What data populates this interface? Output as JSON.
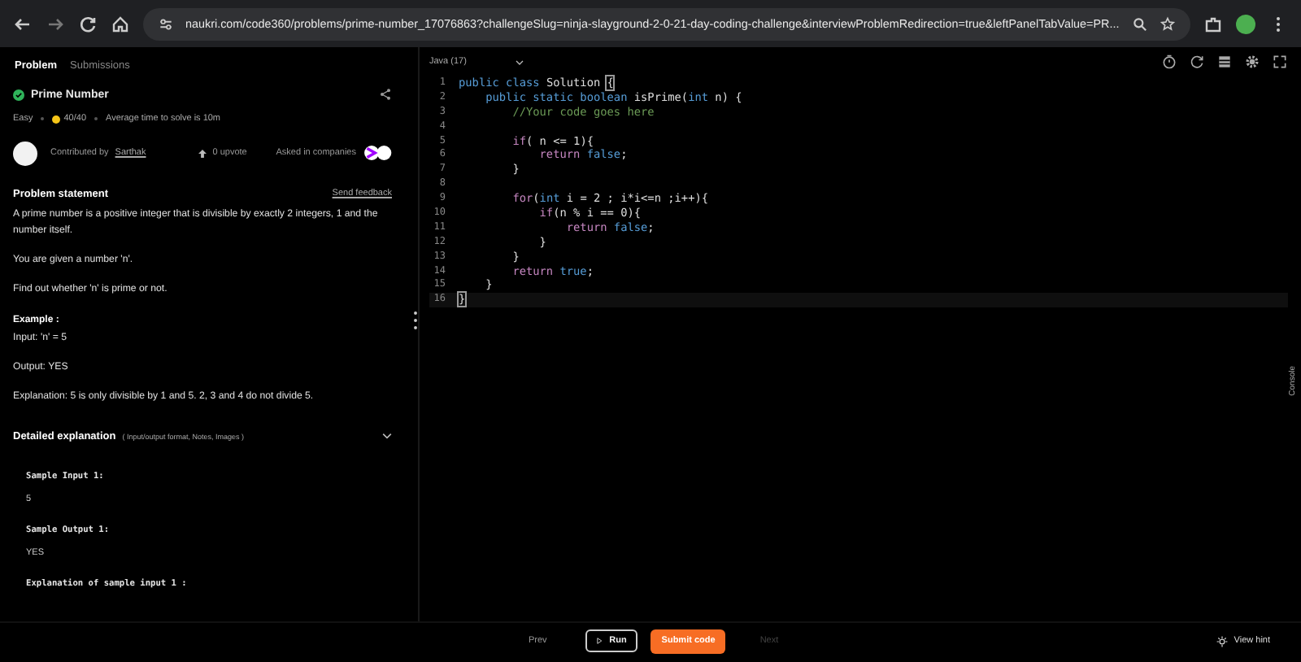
{
  "browser": {
    "url": "naukri.com/code360/problems/prime-number_17076863?challengeSlug=ninja-slayground-2-0-21-day-coding-challenge&interviewProblemRedirection=true&leftPanelTabValue=PR..."
  },
  "tabs": [
    {
      "label": "Problem",
      "selected": true
    },
    {
      "label": "Submissions",
      "selected": false
    }
  ],
  "problem": {
    "title": "Prime Number",
    "solved": true,
    "difficulty": "Easy",
    "score": "40/40",
    "avg_time": "Average time to solve is 10m",
    "contributed_label": "Contributed by",
    "contributor": "Sarthak",
    "upvotes": "0 upvote",
    "asked_in": "Asked in companies"
  },
  "statement": {
    "heading": "Problem statement",
    "feedback": "Send feedback",
    "paragraphs": [
      "A prime number is a positive integer that is divisible by exactly 2 integers, 1 and the number itself.",
      "You are given a number 'n'.",
      "Find out whether 'n' is prime or not."
    ],
    "example_heading": "Example :",
    "example_lines": [
      "Input: 'n' = 5",
      "Output: YES",
      "Explanation: 5 is only divisible by 1 and 5. 2, 3 and 4 do not divide 5."
    ]
  },
  "detailed": {
    "heading": "Detailed explanation",
    "hint": "( Input/output format, Notes, Images )",
    "expanded": true,
    "items": [
      {
        "kind": "label",
        "text": "Sample Input 1:"
      },
      {
        "kind": "value",
        "text": "5"
      },
      {
        "kind": "label",
        "text": "Sample Output 1:"
      },
      {
        "kind": "value",
        "text": "YES"
      },
      {
        "kind": "label",
        "text": "Explanation of sample input 1 :"
      }
    ]
  },
  "editor": {
    "language": "Java (17)",
    "lines": [
      {
        "number": "1",
        "tokens": [
          {
            "text": "public class ",
            "kind": "kw"
          },
          {
            "text": "Solution ",
            "kind": "plain"
          },
          {
            "text": "{",
            "kind": "match"
          }
        ]
      },
      {
        "number": "2",
        "tokens": [
          {
            "text": "    public static boolean ",
            "kind": "kw"
          },
          {
            "text": "isPrime(",
            "kind": "plain"
          },
          {
            "text": "int",
            "kind": "kw"
          },
          {
            "text": " n) {",
            "kind": "plain"
          }
        ]
      },
      {
        "number": "3",
        "tokens": [
          {
            "text": "        //Your code goes here",
            "kind": "comment"
          }
        ]
      },
      {
        "number": "4"
      },
      {
        "number": "5",
        "tokens": [
          {
            "text": "        if",
            "kind": "ctl"
          },
          {
            "text": "( n <= 1){",
            "kind": "plain"
          }
        ]
      },
      {
        "number": "6",
        "tokens": [
          {
            "text": "            return ",
            "kind": "ctl"
          },
          {
            "text": "false",
            "kind": "kw"
          },
          {
            "text": ";",
            "kind": "plain"
          }
        ]
      },
      {
        "number": "7",
        "tokens": [
          {
            "text": "        }",
            "kind": "plain"
          }
        ]
      },
      {
        "number": "8"
      },
      {
        "number": "9",
        "tokens": [
          {
            "text": "        for",
            "kind": "ctl"
          },
          {
            "text": "(",
            "kind": "plain"
          },
          {
            "text": "int",
            "kind": "kw"
          },
          {
            "text": " i = 2 ; i*i<=n ;i++){",
            "kind": "plain"
          }
        ]
      },
      {
        "number": "10",
        "tokens": [
          {
            "text": "            if",
            "kind": "ctl"
          },
          {
            "text": "(n % i == 0){",
            "kind": "plain"
          }
        ]
      },
      {
        "number": "11",
        "tokens": [
          {
            "text": "                return ",
            "kind": "ctl"
          },
          {
            "text": "false",
            "kind": "kw"
          },
          {
            "text": ";",
            "kind": "plain"
          }
        ]
      },
      {
        "number": "12",
        "tokens": [
          {
            "text": "            }",
            "kind": "plain"
          }
        ]
      },
      {
        "number": "13",
        "tokens": [
          {
            "text": "        }",
            "kind": "plain"
          }
        ]
      },
      {
        "number": "14",
        "tokens": [
          {
            "text": "        return ",
            "kind": "ctl"
          },
          {
            "text": "true",
            "kind": "kw"
          },
          {
            "text": ";",
            "kind": "plain"
          }
        ]
      },
      {
        "number": "15",
        "tokens": [
          {
            "text": "    }",
            "kind": "plain"
          }
        ]
      },
      {
        "number": "16",
        "tokens": [
          {
            "text": "}",
            "kind": "match"
          }
        ],
        "current": true
      }
    ]
  },
  "console_label": "Console",
  "footer": {
    "prev": "Prev",
    "run": "Run",
    "submit": "Submit code",
    "next": "Next",
    "hint": "View hint"
  }
}
